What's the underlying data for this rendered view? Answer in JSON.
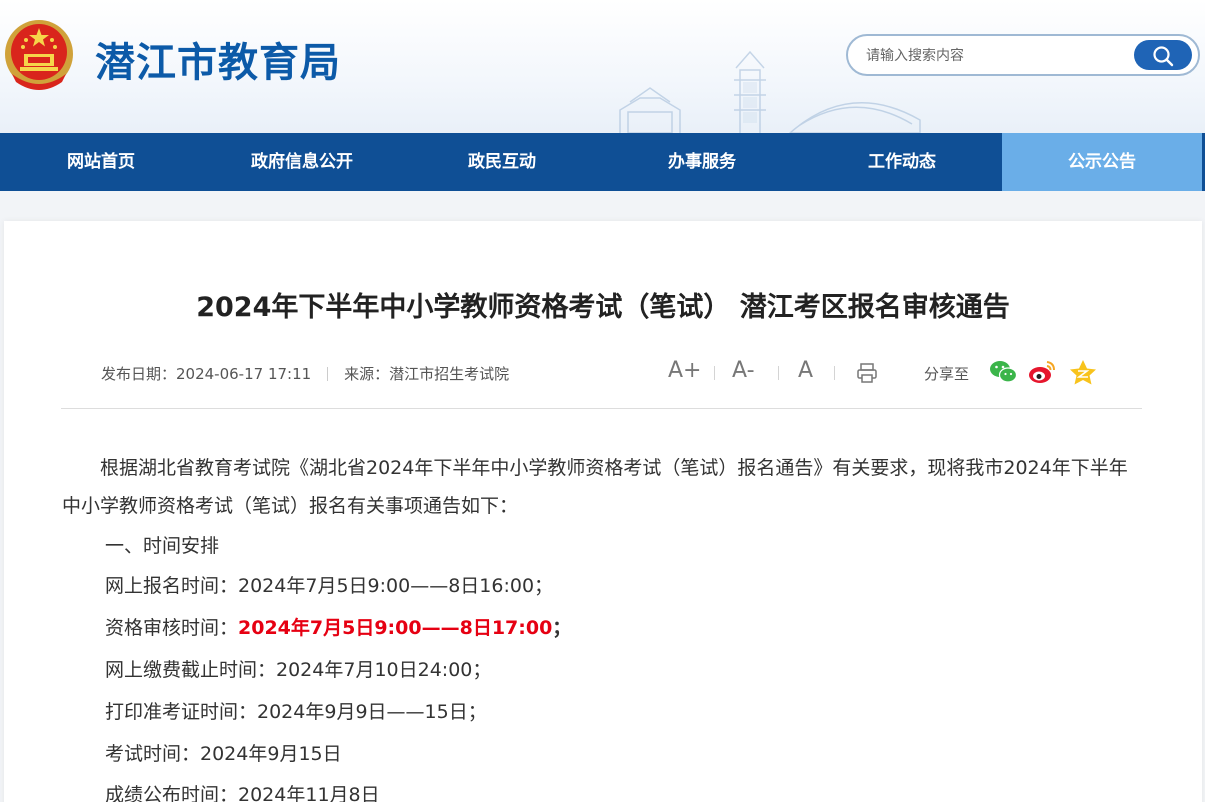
{
  "header": {
    "site_title": "潜江市教育局",
    "search_placeholder": "请输入搜索内容"
  },
  "nav": {
    "items": [
      {
        "label": "网站首页"
      },
      {
        "label": "政府信息公开"
      },
      {
        "label": "政民互动"
      },
      {
        "label": "办事服务"
      },
      {
        "label": "工作动态"
      },
      {
        "label": "公示公告"
      }
    ],
    "active_index": 5
  },
  "article": {
    "title": "2024年下半年中小学教师资格考试（笔试） 潜江考区报名审核通告",
    "meta": {
      "date": "发布日期：2024-06-17 17:11",
      "source": "来源：潜江市招生考试院"
    },
    "tools": {
      "font_large": "A+",
      "font_small": "A-",
      "font_default": "A",
      "share_label": "分享至"
    },
    "intro": "根据湖北省教育考试院《湖北省2024年下半年中小学教师资格考试（笔试）报名通告》有关要求，现将我市2024年下半年中小学教师资格考试（笔试）报名有关事项通告如下：",
    "section_heading": "一、时间安排",
    "schedule": {
      "online_registration": "网上报名时间：2024年7月5日9:00——8日16:00；",
      "review_label": "资格审核时间：",
      "review_value": "2024年7月5日9:00——8日17:00",
      "review_suffix": "；",
      "payment_deadline": "网上缴费截止时间：2024年7月10日24:00；",
      "admission_ticket": "打印准考证时间：2024年9月9日——15日；",
      "exam_time": "考试时间：2024年9月15日",
      "results_time": "成绩公布时间：2024年11月8日"
    }
  },
  "colors": {
    "nav_bg": "#0f4f95",
    "nav_active": "#6aaee8",
    "title_blue": "#0c5aa8",
    "highlight_red": "#e60012"
  }
}
